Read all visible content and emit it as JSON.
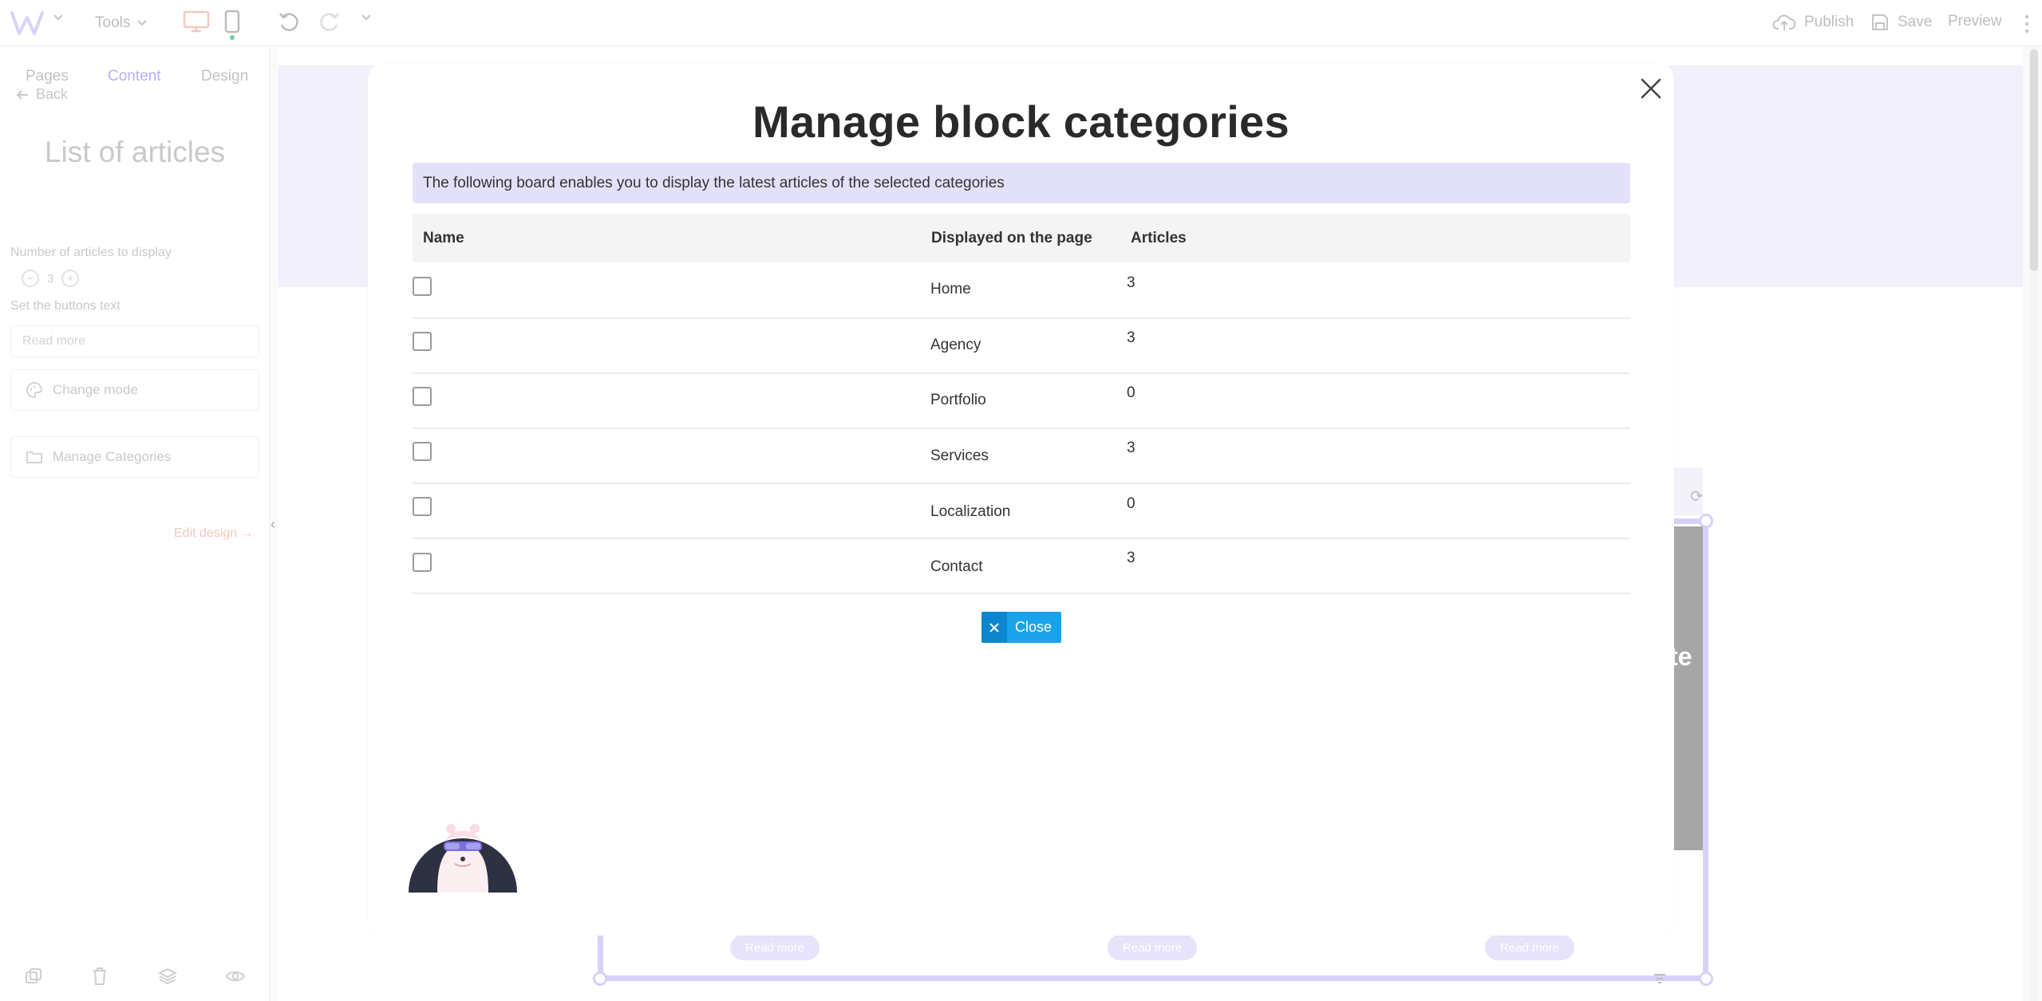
{
  "topbar": {
    "tools_label": "Tools",
    "publish_label": "Publish",
    "save_label": "Save",
    "preview_label": "Preview"
  },
  "left_panel": {
    "tabs": [
      "Pages",
      "Content",
      "Design"
    ],
    "active_tab": "Content",
    "back_label": "Back",
    "title": "List of articles",
    "articles_count_label": "Number of articles to display",
    "articles_count_value": "3",
    "buttons_text_label": "Set the buttons text",
    "buttons_text_placeholder": "Read more",
    "change_mode_label": "Change mode",
    "manage_categories_label": "Manage Categories",
    "edit_design_label": "Edit design →"
  },
  "background": {
    "read_more_labels": [
      "Read more",
      "Read more",
      "Read more"
    ],
    "card_text_fragment": "te"
  },
  "modal": {
    "title": "Manage block categories",
    "info": "The following board enables you to display the latest articles of the selected categories",
    "columns": {
      "name": "Name",
      "displayed_on": "Displayed on the page",
      "articles": "Articles"
    },
    "rows": [
      {
        "name": "",
        "page": "Home",
        "articles": "3",
        "checked": false
      },
      {
        "name": "",
        "page": "Agency",
        "articles": "3",
        "checked": false
      },
      {
        "name": "",
        "page": "Portfolio",
        "articles": "0",
        "checked": false
      },
      {
        "name": "",
        "page": "Services",
        "articles": "3",
        "checked": false
      },
      {
        "name": "",
        "page": "Localization",
        "articles": "0",
        "checked": false
      },
      {
        "name": "",
        "page": "Contact",
        "articles": "3",
        "checked": false
      }
    ],
    "close_label": "Close"
  },
  "colors": {
    "accent_lavender": "#b7b0ef",
    "info_bar": "#e3e1fa",
    "close_button": "#1aa3ea",
    "close_button_icon": "#0e86cf"
  }
}
